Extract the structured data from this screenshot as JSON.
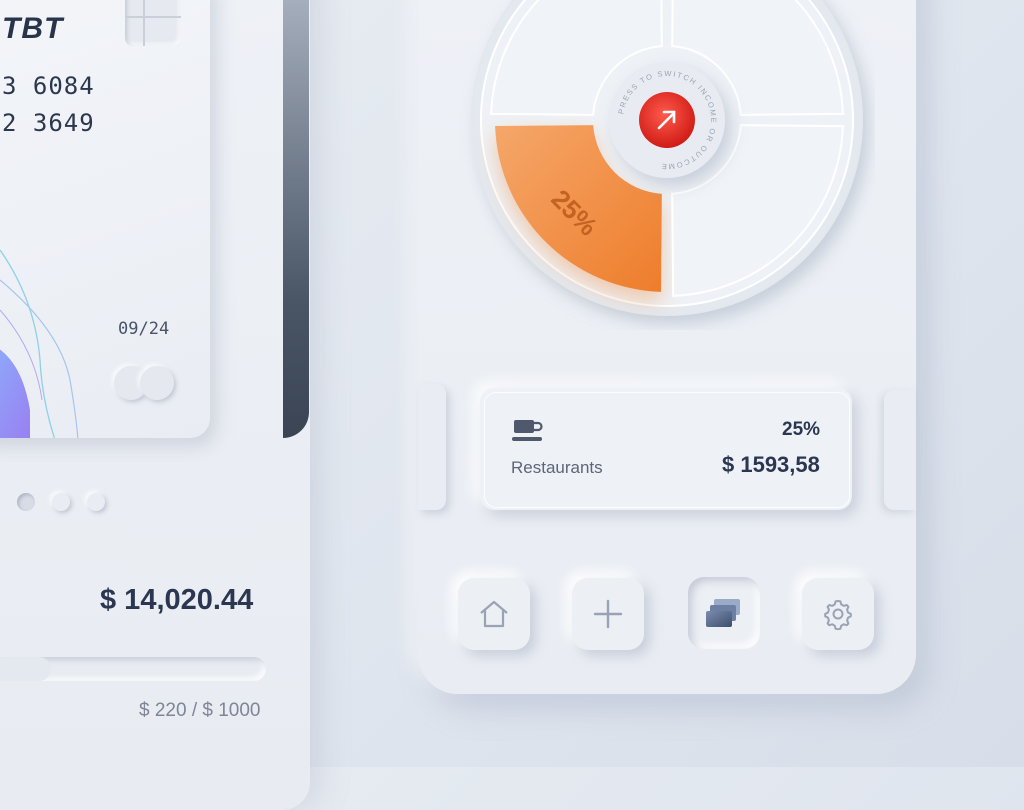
{
  "card": {
    "brand": "TBT",
    "number_line1": "3 6084",
    "number_line2": "2 3649",
    "expiry": "09/24"
  },
  "wallet": {
    "balance": "$ 14,020.44",
    "limit_text": "$ 220 / $ 1000",
    "limit_progress": 0.22
  },
  "chart_data": {
    "type": "pie",
    "segments": [
      {
        "label": "25%",
        "value": 25,
        "color": "#f08a3a",
        "highlighted": true
      },
      {
        "value": 25,
        "highlighted": false
      },
      {
        "value": 25,
        "highlighted": false
      },
      {
        "value": 25,
        "highlighted": false
      }
    ],
    "center_button_text": "PRESS TO SWITCH INCOME OR OUTCOME"
  },
  "category": {
    "icon": "coffee-cup-icon",
    "name": "Restaurants",
    "percent": "25%",
    "amount": "$ 1593,58"
  },
  "nav": {
    "items": [
      {
        "icon": "home-icon",
        "active": false
      },
      {
        "icon": "plus-icon",
        "active": false
      },
      {
        "icon": "cards-icon",
        "active": true
      },
      {
        "icon": "gear-icon",
        "active": false
      }
    ]
  },
  "colors": {
    "accent": "#f08a3a",
    "button_red": "#e02a22",
    "text_dark": "#2b3650"
  }
}
